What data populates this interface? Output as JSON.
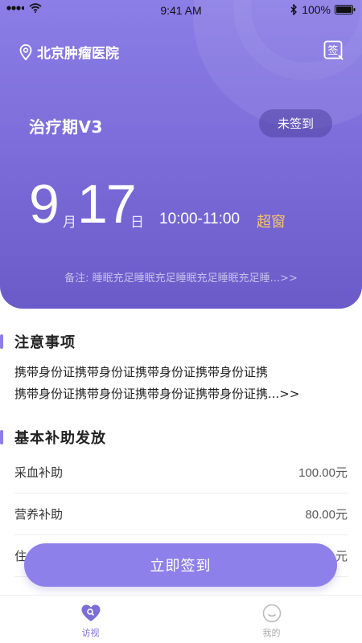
{
  "status_bar": {
    "time": "9:41 AM",
    "battery": "100%"
  },
  "header": {
    "hospital_name": "北京肿瘤医院",
    "sign_icon_glyph": "签"
  },
  "visit": {
    "phase": "治疗期V3",
    "sign_status": "未签到",
    "month": "9",
    "month_unit": "月",
    "day": "17",
    "day_unit": "日",
    "time_range": "10:00-11:00",
    "window_tag": "超窗",
    "remark": "备注: 睡眠充足睡眠充足睡眠充足睡眠充足睡...>>"
  },
  "notice": {
    "title": "注意事项",
    "line1": "携带身份证携带身份证携带身份证携带身份证携",
    "line2": "携带身份证携带身份证携带身份证携带身份证携...>>"
  },
  "subsidy": {
    "title": "基本补助发放",
    "items": [
      {
        "label": "采血补助",
        "amount": "100.00元"
      },
      {
        "label": "营养补助",
        "amount": "80.00元"
      },
      {
        "label": "住",
        "amount": "元"
      }
    ]
  },
  "cta": {
    "label": "立即签到"
  },
  "tabbar": {
    "tabs": [
      {
        "label": "访视",
        "icon": "heart-search-icon",
        "active": true
      },
      {
        "label": "我的",
        "icon": "smile-face-icon",
        "active": false
      }
    ]
  },
  "colors": {
    "accent": "#8b7ee6",
    "window_tag": "#f7c76a"
  }
}
